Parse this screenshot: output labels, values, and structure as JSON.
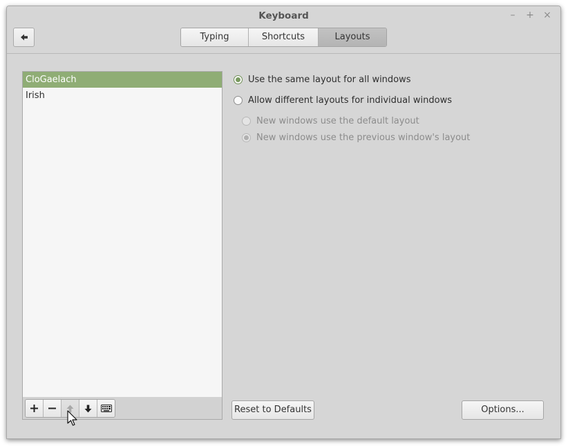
{
  "window": {
    "title": "Keyboard",
    "controls": {
      "minimize": "–",
      "maximize": "+",
      "close": "×"
    }
  },
  "header": {
    "back_icon": "arrow-left-icon",
    "tabs": [
      {
        "label": "Typing",
        "active": false
      },
      {
        "label": "Shortcuts",
        "active": false
      },
      {
        "label": "Layouts",
        "active": true
      }
    ]
  },
  "layouts": {
    "items": [
      {
        "label": "CloGaelach",
        "selected": true
      },
      {
        "label": "Irish",
        "selected": false
      }
    ],
    "toolbar": {
      "add_icon": "plus-icon",
      "remove_icon": "minus-icon",
      "move_up_icon": "arrow-up-icon",
      "move_down_icon": "arrow-down-icon",
      "keyboard_icon": "keyboard-icon",
      "move_up_enabled": false
    }
  },
  "options": {
    "same_layout": "Use the same layout for all windows",
    "different_layouts": "Allow different layouts for individual windows",
    "new_default": "New windows use the default layout",
    "new_previous": "New windows use the previous window's layout",
    "selected": "same_layout"
  },
  "buttons": {
    "reset": "Reset to Defaults",
    "options": "Options..."
  },
  "colors": {
    "accent": "#8fad75",
    "radio_dot": "#7a9a60",
    "window_bg": "#d6d6d6"
  }
}
